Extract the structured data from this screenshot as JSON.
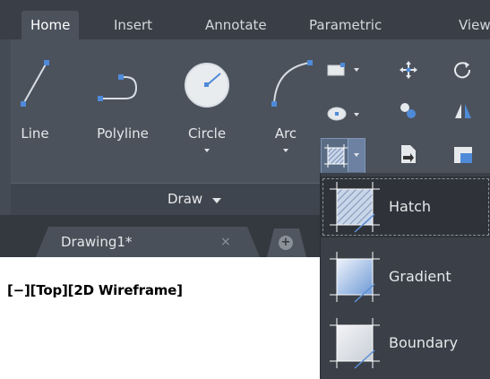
{
  "ribbon": {
    "tabs": [
      {
        "label": "Home",
        "active": true
      },
      {
        "label": "Insert",
        "active": false
      },
      {
        "label": "Annotate",
        "active": false
      },
      {
        "label": "Parametric",
        "active": false
      },
      {
        "label": "View",
        "active": false
      }
    ],
    "draw_panel": {
      "tools": [
        {
          "label": "Line",
          "icon": "line-icon"
        },
        {
          "label": "Polyline",
          "icon": "polyline-icon"
        },
        {
          "label": "Circle",
          "icon": "circle-icon"
        },
        {
          "label": "Arc",
          "icon": "arc-icon"
        }
      ],
      "footer_label": "Draw"
    }
  },
  "document": {
    "tab_label": "Drawing1*",
    "close_glyph": "×",
    "new_tab_glyph": "+",
    "viewport_label": "[−][Top][2D Wireframe]"
  },
  "hatch_dropdown": {
    "items": [
      {
        "label": "Hatch",
        "icon": "hatch-icon",
        "active": true
      },
      {
        "label": "Gradient",
        "icon": "gradient-icon",
        "active": false
      },
      {
        "label": "Boundary",
        "icon": "boundary-icon",
        "active": false
      }
    ]
  },
  "colors": {
    "ribbon_bg": "#454b55",
    "panel_bg": "#4b525c",
    "tab_text": "#d4d8dc",
    "accent_blue": "#5b8fd6"
  }
}
